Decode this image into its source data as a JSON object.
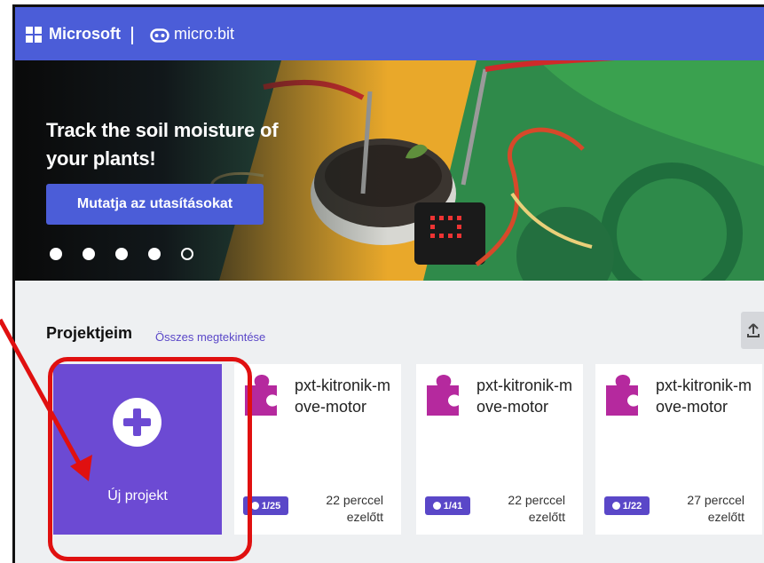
{
  "topbar": {
    "brand": "Microsoft",
    "product": "micro:bit",
    "colors": {
      "bar": "#4b5dd8"
    }
  },
  "hero": {
    "title": "Track the soil moisture of your plants!",
    "button_label": "Mutatja az utasításokat",
    "carousel": {
      "slide_count": 5,
      "active_index": 4
    }
  },
  "projects": {
    "heading": "Projektjeim",
    "view_all": "Összes megtekintése",
    "new_project_label": "Új projekt",
    "cards": [
      {
        "name": "pxt-kitronik-move-motor",
        "badge": "1/25",
        "time": "22 perccel ezelőtt"
      },
      {
        "name": "pxt-kitronik-move-motor",
        "badge": "1/41",
        "time": "22 perccel ezelőtt"
      },
      {
        "name": "pxt-kitronik-move-motor",
        "badge": "1/22",
        "time": "27 perccel ezelőtt"
      }
    ]
  },
  "annotation": {
    "color": "#e01010"
  },
  "icons": [
    "microsoft-logo-icon",
    "microbit-icon",
    "plus-icon",
    "puzzle-icon",
    "upload-icon"
  ]
}
